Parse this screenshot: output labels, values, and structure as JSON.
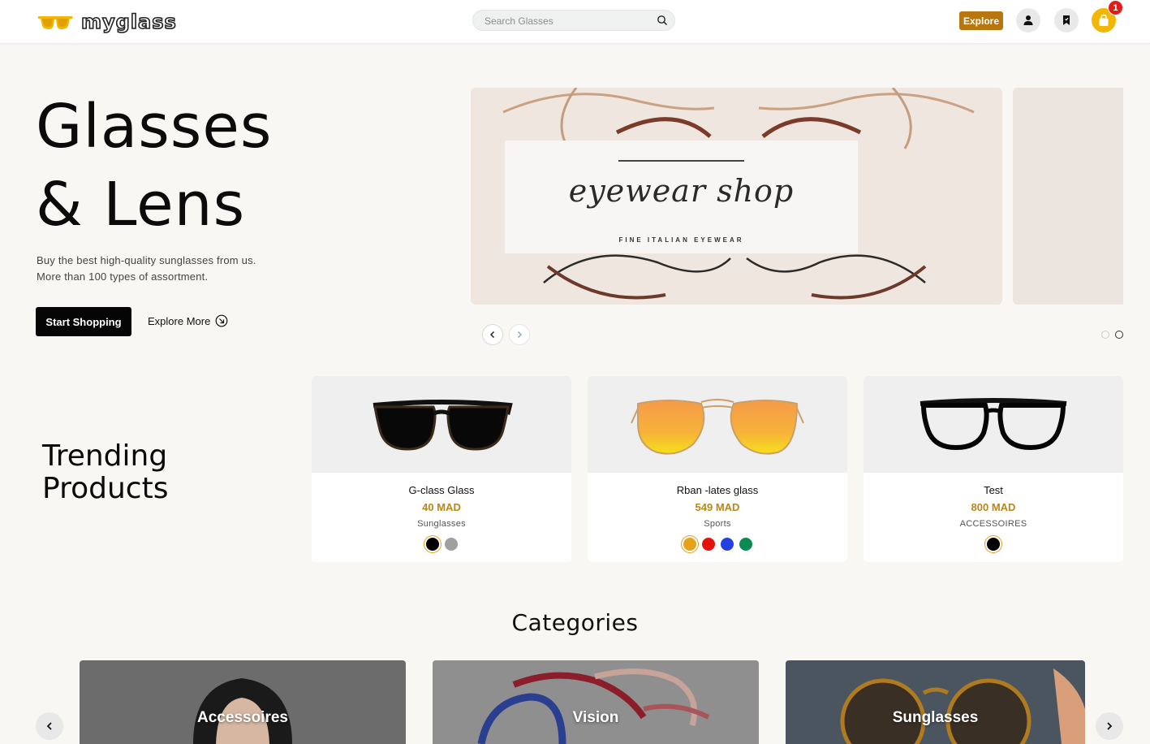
{
  "header": {
    "brand": "myglass",
    "search_placeholder": "Search Glasses",
    "explore_label": "Explore",
    "cart_count": "1",
    "icons": [
      "sunglasses-logo-icon",
      "search-icon",
      "user-icon",
      "bookmark-icon",
      "shopping-bag-icon"
    ]
  },
  "hero": {
    "title_line1": "Glasses",
    "title_line2": "& Lens",
    "subtitle_line1": "Buy the best high-quality sunglasses from us.",
    "subtitle_line2": "More than 100 types of assortment.",
    "start_label": "Start Shopping",
    "explore_more_label": "Explore More"
  },
  "carousel": {
    "slide_title": "eyewear shop",
    "slide_subtitle": "FINE ITALIAN EYEWEAR",
    "active_dot_index": 1,
    "dots": 2
  },
  "trending": {
    "title_line1": "Trending",
    "title_line2": "Products",
    "products": [
      {
        "name": "G-class Glass",
        "price": "40 MAD",
        "category": "Sunglasses",
        "colors": [
          "#000000",
          "#a0a0a0"
        ]
      },
      {
        "name": "Rban -lates glass",
        "price": "549 MAD",
        "category": "Sports",
        "colors": [
          "#e8a21a",
          "#e3120b",
          "#2540e0",
          "#0b8a52"
        ]
      },
      {
        "name": "Test",
        "price": "800 MAD",
        "category": "ACCESSOIRES",
        "colors": [
          "#000000"
        ]
      }
    ]
  },
  "categories": {
    "title": "Categories",
    "items": [
      {
        "label": "Accessoires"
      },
      {
        "label": "Vision"
      },
      {
        "label": "Sunglasses"
      }
    ]
  },
  "colors": {
    "accent": "#b7760e",
    "price": "#b9861a",
    "cart": "#f2b705",
    "badge": "#e21b1b"
  }
}
